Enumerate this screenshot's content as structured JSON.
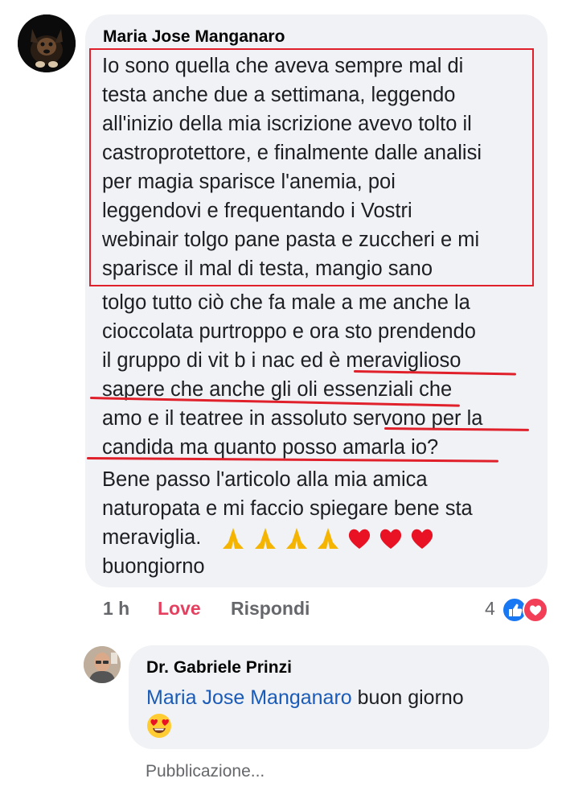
{
  "comment": {
    "author": "Maria Jose Manganaro",
    "lines": [
      "Io sono quella che aveva sempre mal di",
      "testa anche due a settimana, leggendo",
      "all'inizio della mia iscrizione avevo tolto il",
      "castroprotettore, e finalmente dalle analisi",
      "per magia sparisce l'anemia, poi",
      "leggendovi e frequentando i Vostri",
      "webinair tolgo pane pasta e zuccheri e mi",
      "sparisce il mal di testa, mangio sano",
      "tolgo tutto ciò che fa male a me anche la",
      "cioccolata purtroppo e ora sto prendendo",
      "il gruppo di vit b i nac ed è  meraviglioso",
      "sapere che anche gli oli essenziali che",
      "amo e il teatree in assoluto servono per la",
      "candida ma quanto posso amarla io?",
      "Bene passo l'articolo alla mia amica",
      "naturopata e mi faccio spiegare bene sta",
      "meraviglia.",
      "buongiorno"
    ],
    "emoji_line_icons": [
      "pray-icon",
      "pray-icon",
      "pray-icon",
      "pray-icon",
      "heart-icon",
      "heart-icon",
      "heart-icon"
    ]
  },
  "actions": {
    "time": "1 h",
    "love": "Love",
    "reply": "Rispondi",
    "reaction_count": "4"
  },
  "reply": {
    "author": "Dr. Gabriele Prinzi",
    "mention": "Maria Jose Manganaro",
    "text": " buon giorno",
    "emoji": "heart-eyes-icon"
  },
  "footer": {
    "status": "Pubblicazione..."
  },
  "colors": {
    "bubble": "#f0f2f5",
    "annotation_red": "#e0202b",
    "love": "#e4405f",
    "mention": "#1a5bb8",
    "like_blue": "#1877f2"
  }
}
